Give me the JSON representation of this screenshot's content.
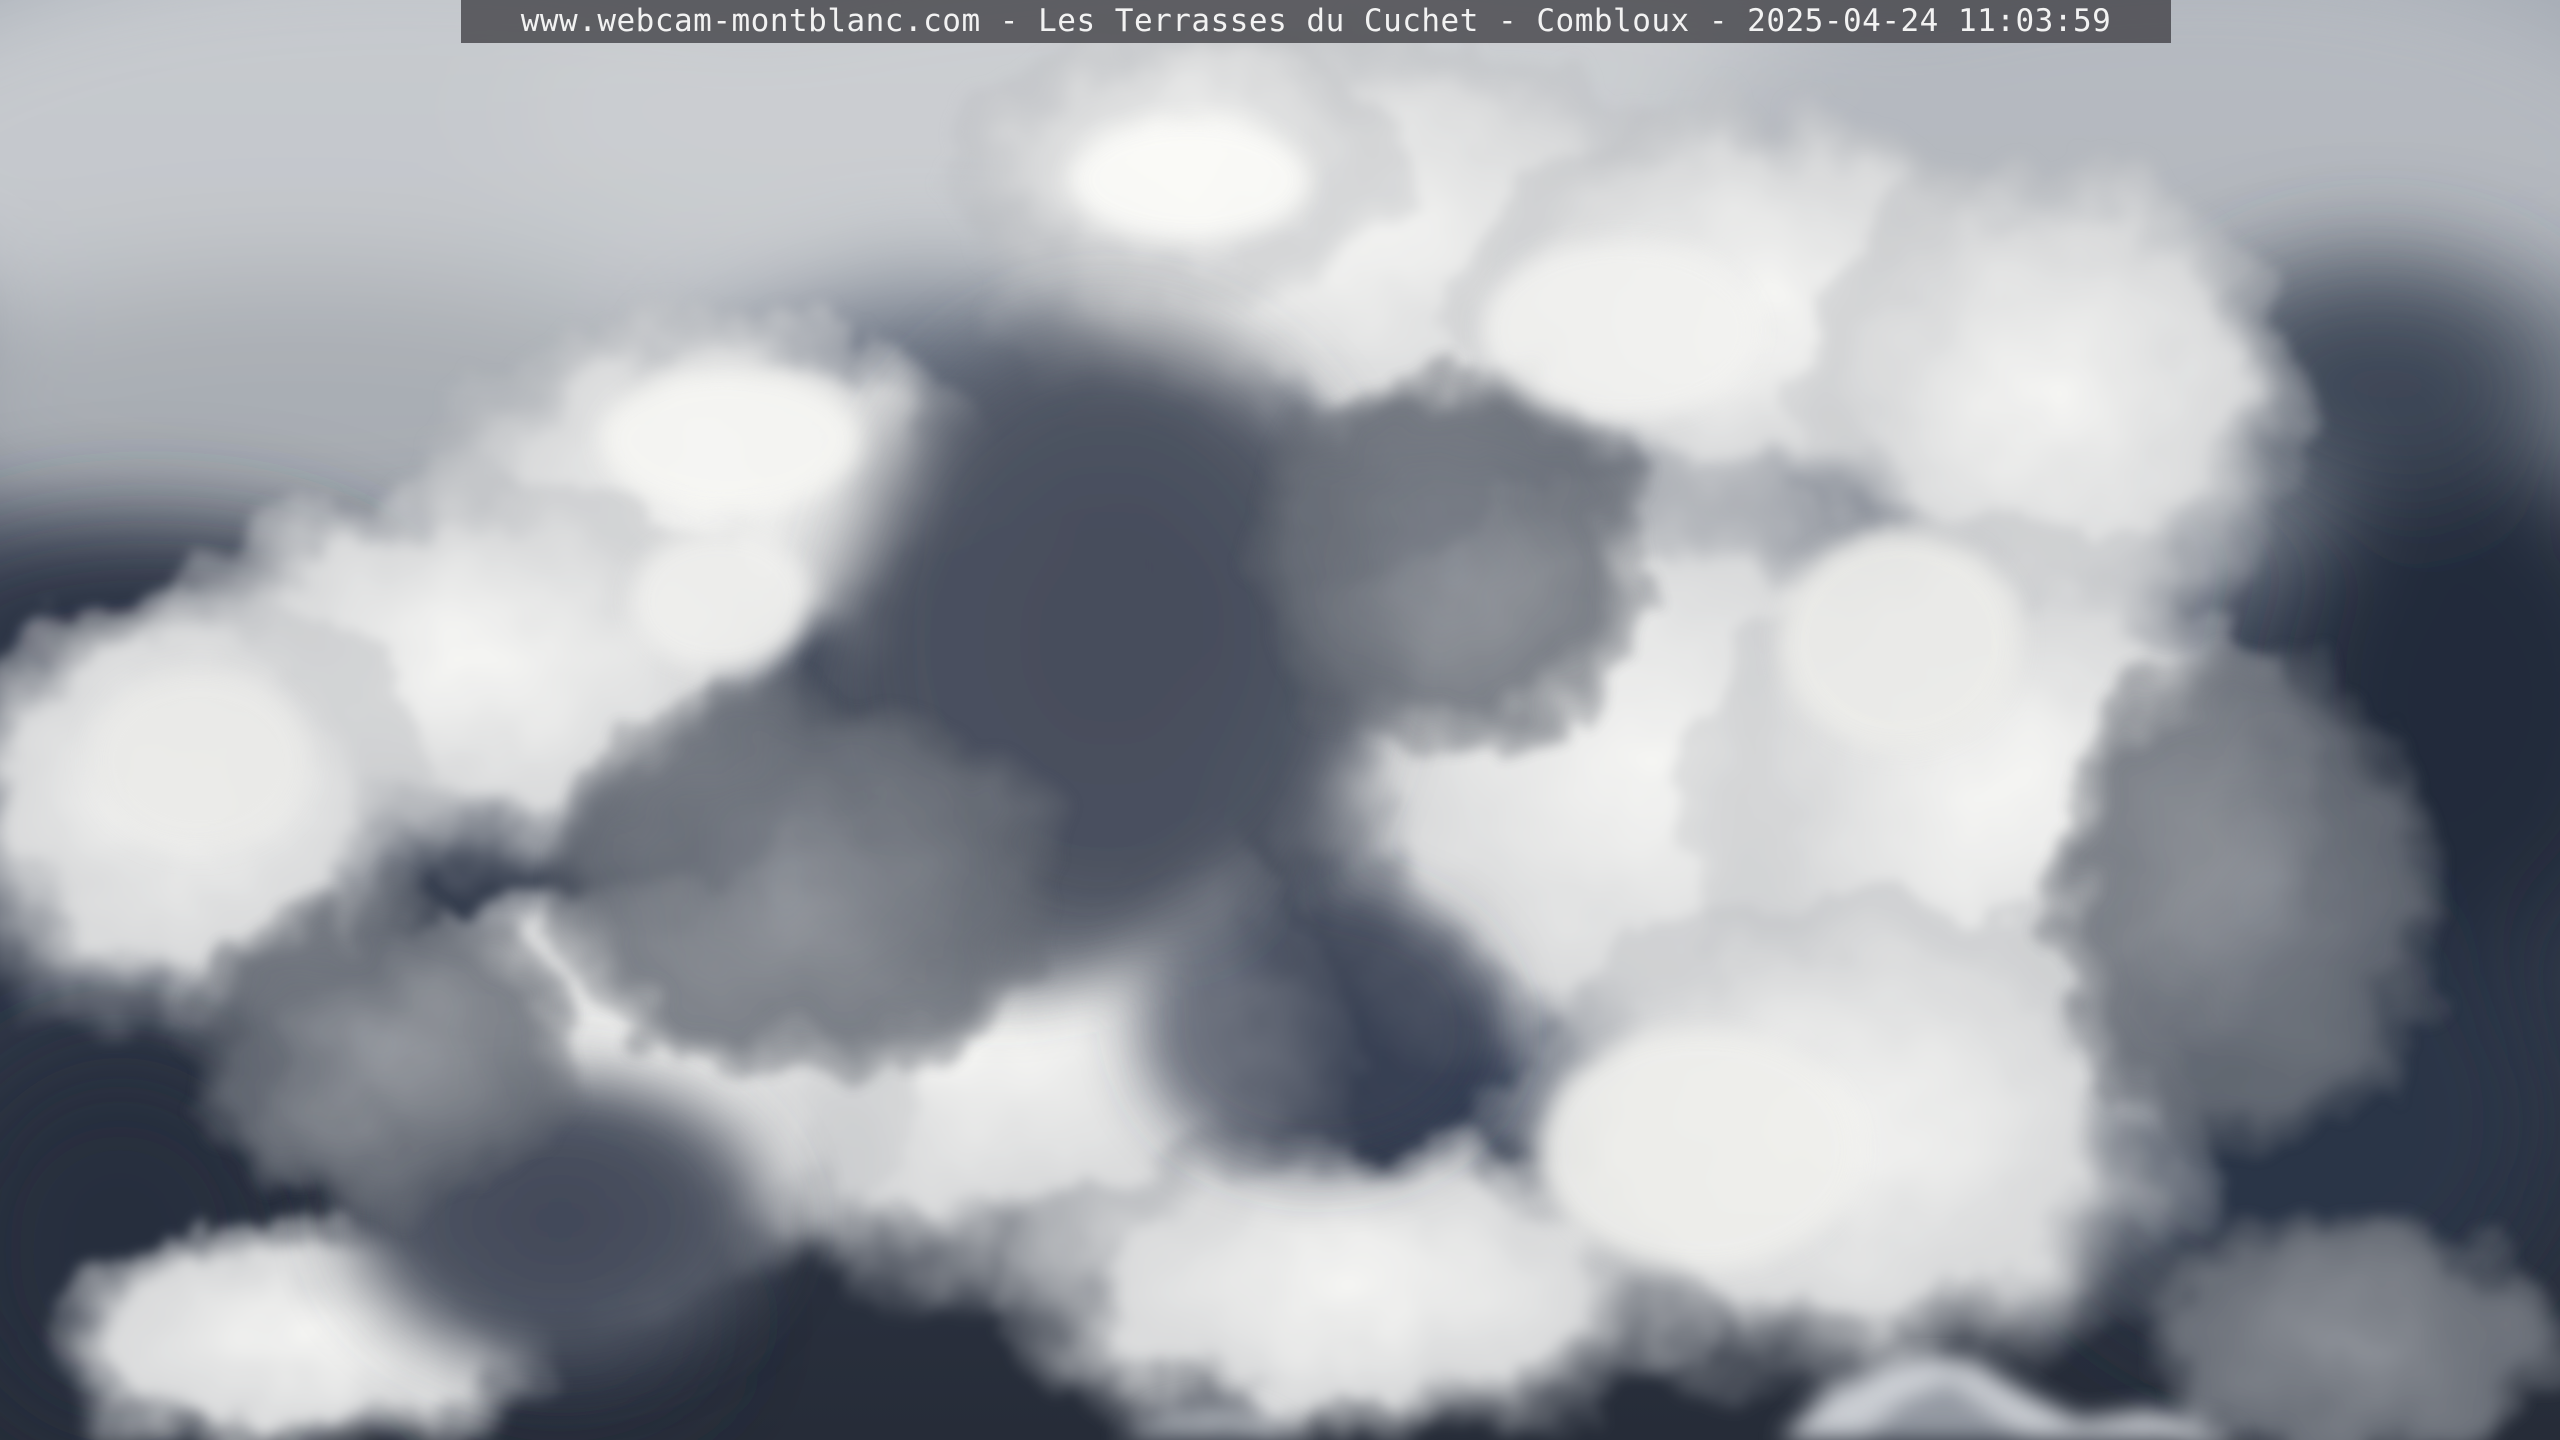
{
  "webcam": {
    "caption": "www.webcam-montblanc.com - Les Terrasses du Cuchet - Combloux - 2025-04-24 11:03:59"
  },
  "scene": {
    "description_colors": {
      "sky_dark": "#2b3444",
      "sky_blue": "#3e4c66",
      "cloud_light": "#f4f4f2",
      "cloud_mid": "#b9bbbd",
      "cloud_shadow": "#5e636c"
    }
  }
}
